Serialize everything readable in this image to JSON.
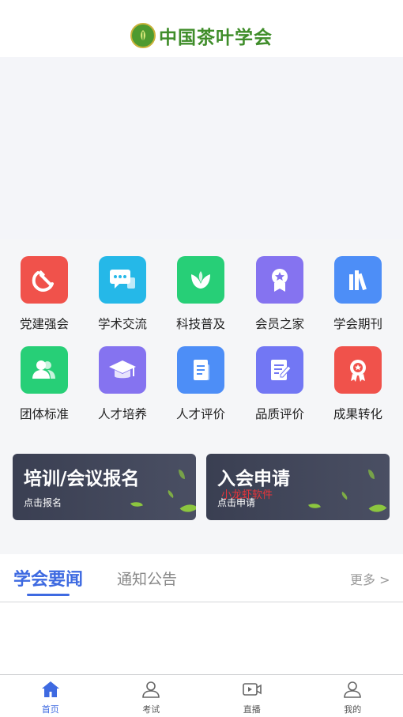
{
  "header": {
    "logo_text": "中国茶叶学会"
  },
  "grid": {
    "items": [
      {
        "label": "党建强会",
        "icon": "hammer-sickle-icon",
        "color": "#f0524b"
      },
      {
        "label": "学术交流",
        "icon": "chat-bubble-icon",
        "color": "#25b8e8"
      },
      {
        "label": "科技普及",
        "icon": "tea-leaf-icon",
        "color": "#27cf77"
      },
      {
        "label": "会员之家",
        "icon": "member-badge-icon",
        "color": "#8573f0"
      },
      {
        "label": "学会期刊",
        "icon": "books-icon",
        "color": "#4d8ef7"
      },
      {
        "label": "团体标准",
        "icon": "group-users-icon",
        "color": "#27cf77"
      },
      {
        "label": "人才培养",
        "icon": "graduation-cap-icon",
        "color": "#8573f0"
      },
      {
        "label": "人才评价",
        "icon": "document-icon",
        "color": "#4d8ef7"
      },
      {
        "label": "品质评价",
        "icon": "edit-document-icon",
        "color": "#7277f4"
      },
      {
        "label": "成果转化",
        "icon": "award-ribbon-icon",
        "color": "#f0524b"
      }
    ]
  },
  "cards": {
    "training": {
      "title": "培训/会议报名",
      "sub": "点击报名"
    },
    "join": {
      "title": "入会申请",
      "sub": "点击申请",
      "watermark": "小龙虾软件"
    }
  },
  "news": {
    "tab_active": "学会要闻",
    "tab_other": "通知公告",
    "more": "更多 >"
  },
  "tabbar": {
    "items": [
      {
        "label": "首页",
        "icon": "home-icon"
      },
      {
        "label": "考试",
        "icon": "user-icon"
      },
      {
        "label": "直播",
        "icon": "video-play-icon"
      },
      {
        "label": "我的",
        "icon": "profile-icon"
      }
    ]
  },
  "colors": {
    "accent": "#3e6ae1",
    "logo_green": "#3f8d2a"
  }
}
